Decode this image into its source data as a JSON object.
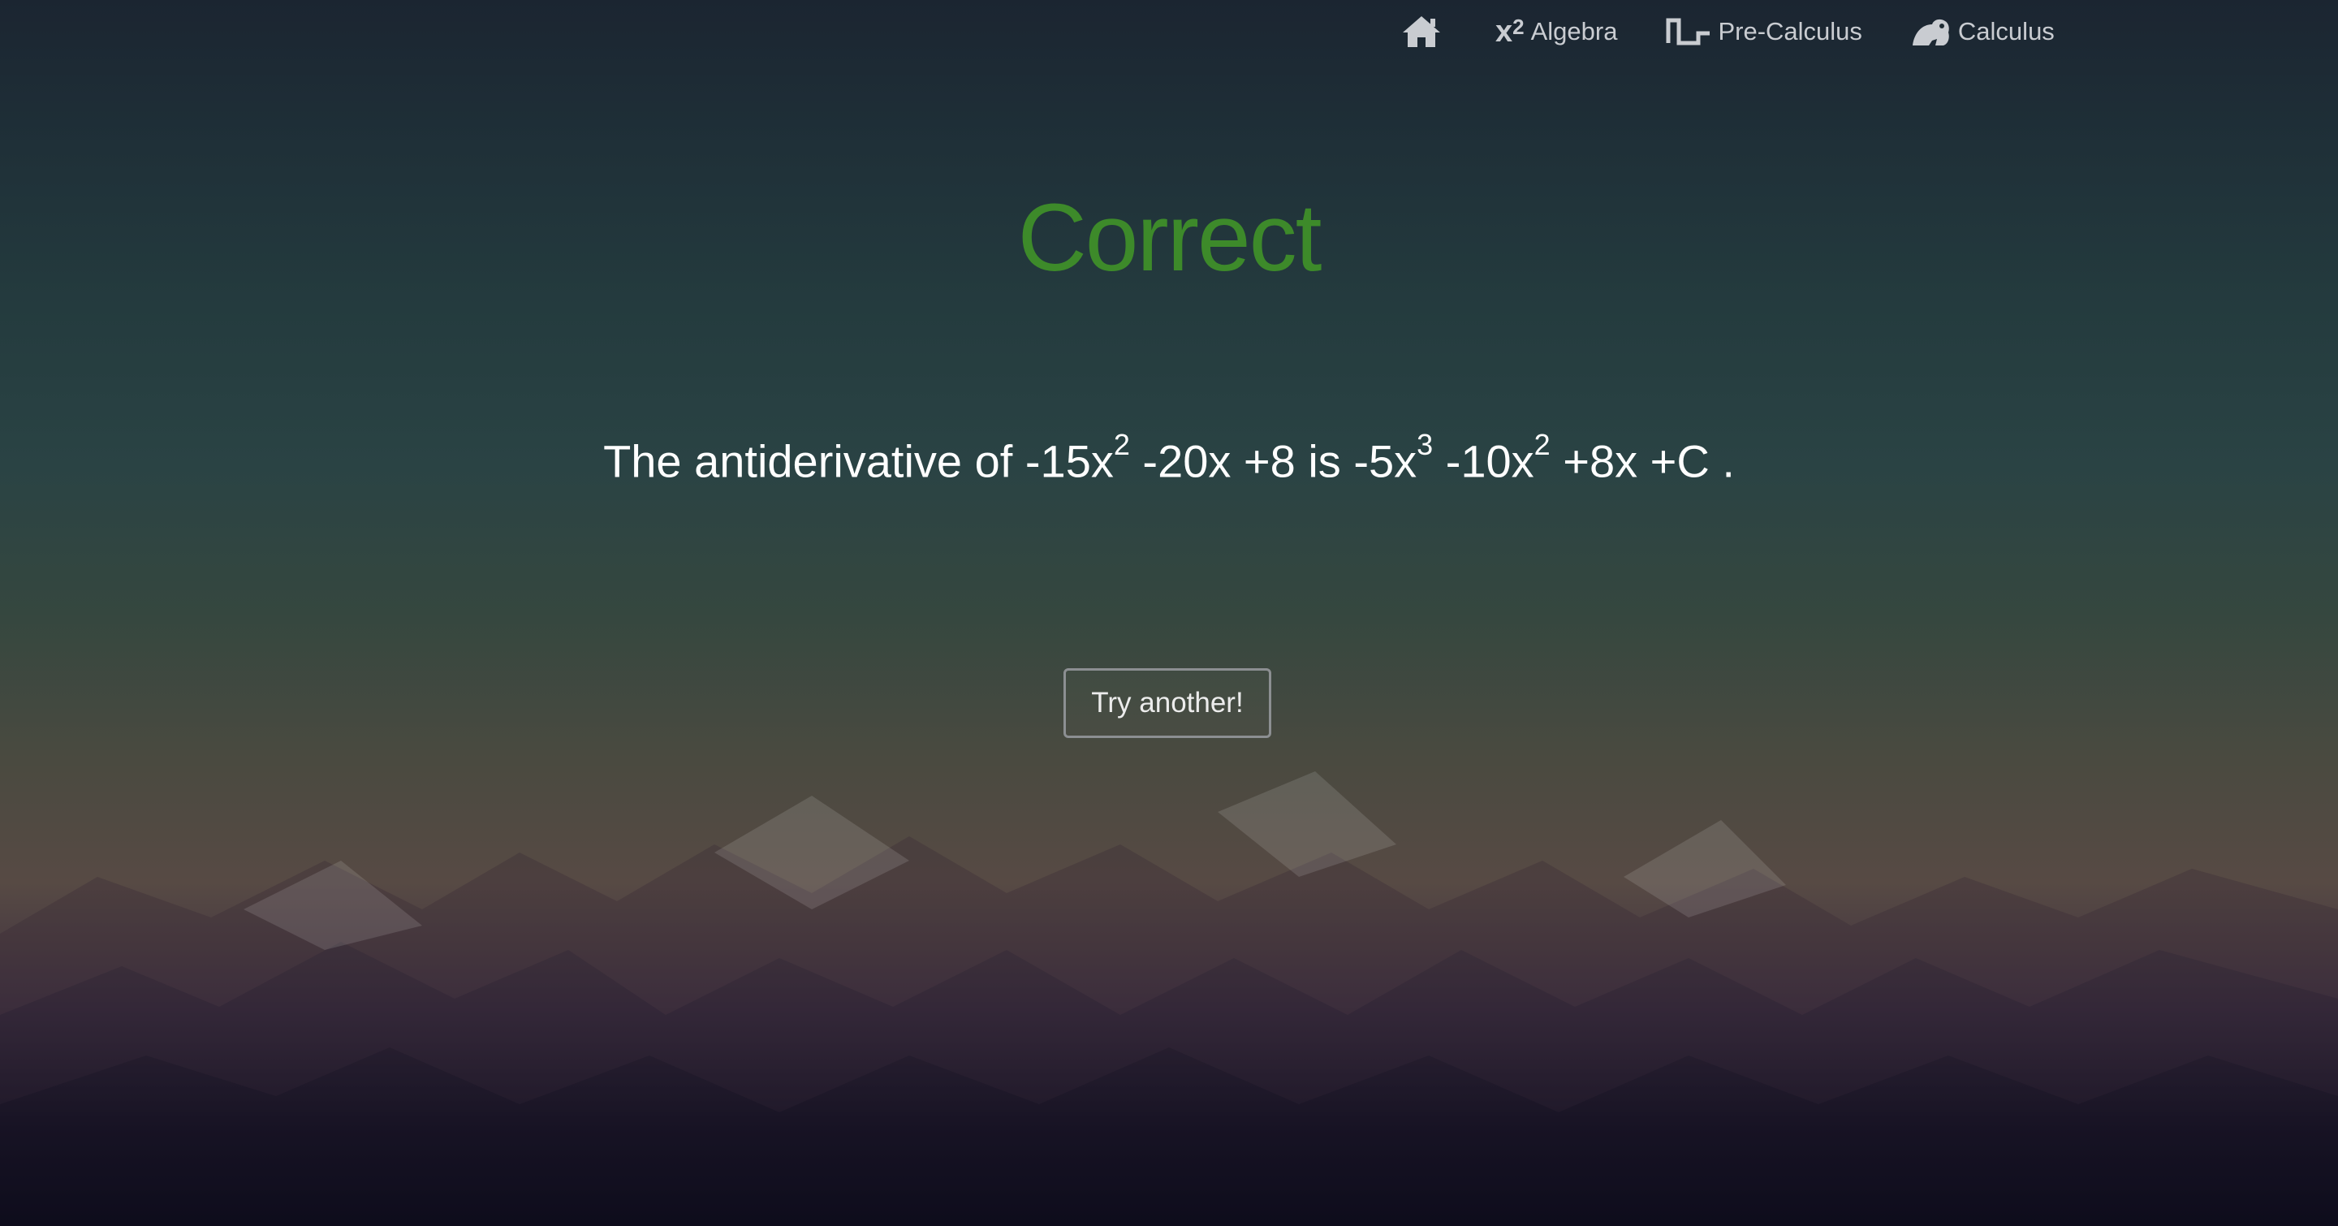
{
  "nav": {
    "home_icon": "home-icon",
    "algebra": {
      "icon_base": "x",
      "icon_sup": "2",
      "label": "Algebra"
    },
    "precalc": {
      "icon": "step-function-icon",
      "label": "Pre-Calculus"
    },
    "calculus": {
      "icon": "frog-icon",
      "label": "Calculus"
    }
  },
  "result": {
    "title": "Correct",
    "title_color": "#3d8a2a"
  },
  "statement": {
    "prefix": "The antiderivative of ",
    "expr1_a": "-15x",
    "expr1_a_exp": "2",
    "expr1_b": " -20x +8",
    "is": " is ",
    "expr2_a": "-5x",
    "expr2_a_exp": "3",
    "expr2_b": " -10x",
    "expr2_b_exp": "2",
    "expr2_c": " +8x +C ."
  },
  "button": {
    "label": "Try another!"
  }
}
